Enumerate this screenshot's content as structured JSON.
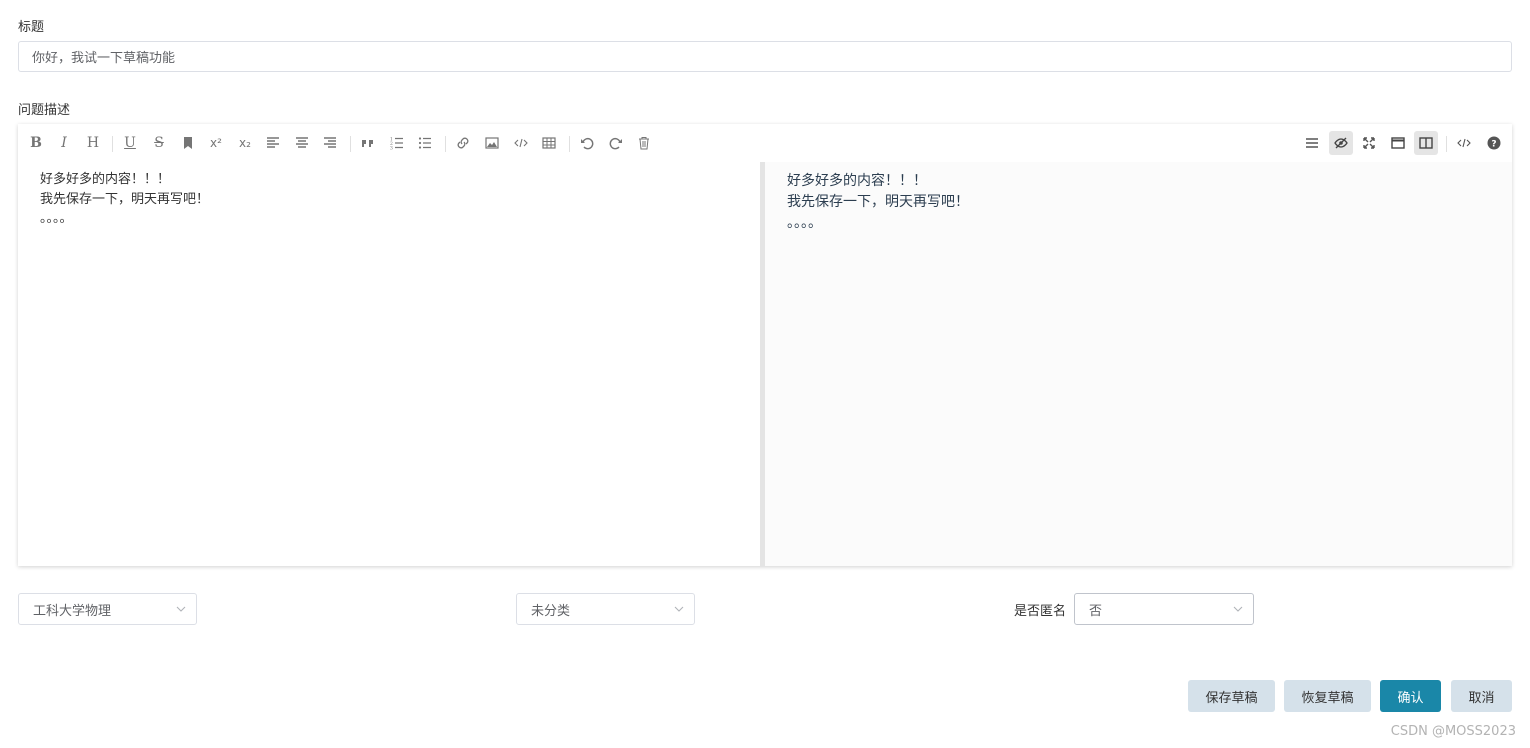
{
  "form": {
    "title_label": "标题",
    "title_value": "你好，我试一下草稿功能",
    "desc_label": "问题描述"
  },
  "editor": {
    "toolbar_left": [
      {
        "name": "bold-icon",
        "glyph": "B"
      },
      {
        "name": "italic-icon",
        "glyph": "I"
      },
      {
        "name": "heading-icon",
        "glyph": "H"
      },
      {
        "name": "underline-icon",
        "glyph": "U"
      },
      {
        "name": "strikethrough-icon",
        "glyph": "S"
      },
      {
        "name": "bookmark-icon",
        "glyph": ""
      },
      {
        "name": "superscript-icon",
        "glyph": "x²"
      },
      {
        "name": "subscript-icon",
        "glyph": "x₂"
      },
      {
        "name": "align-left-icon",
        "glyph": ""
      },
      {
        "name": "align-center-icon",
        "glyph": ""
      },
      {
        "name": "align-right-icon",
        "glyph": ""
      },
      {
        "name": "quote-icon",
        "glyph": ""
      },
      {
        "name": "ordered-list-icon",
        "glyph": ""
      },
      {
        "name": "unordered-list-icon",
        "glyph": ""
      },
      {
        "name": "link-icon",
        "glyph": ""
      },
      {
        "name": "image-icon",
        "glyph": ""
      },
      {
        "name": "code-icon",
        "glyph": ""
      },
      {
        "name": "table-icon",
        "glyph": ""
      },
      {
        "name": "undo-icon",
        "glyph": ""
      },
      {
        "name": "redo-icon",
        "glyph": ""
      },
      {
        "name": "trash-icon",
        "glyph": ""
      }
    ],
    "toolbar_right": [
      {
        "name": "navigation-icon"
      },
      {
        "name": "preview-toggle-icon"
      },
      {
        "name": "fullscreen-icon"
      },
      {
        "name": "window-icon"
      },
      {
        "name": "split-view-icon"
      },
      {
        "name": "html-code-icon"
      },
      {
        "name": "help-icon"
      }
    ],
    "content_lines": [
      "好多好多的内容！！！",
      "我先保存一下，明天再写吧！",
      "。。。。"
    ]
  },
  "filters": {
    "subject_value": "工科大学物理",
    "category_value": "未分类",
    "anonymous_label": "是否匿名",
    "anonymous_value": "否"
  },
  "actions": {
    "save_draft": "保存草稿",
    "restore_draft": "恢复草稿",
    "confirm": "确认",
    "cancel": "取消"
  },
  "watermark": "CSDN @MOSS2023"
}
